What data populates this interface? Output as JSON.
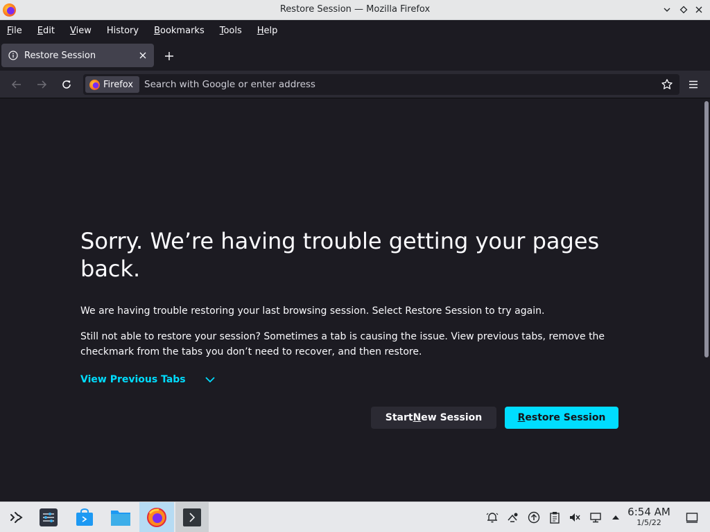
{
  "window": {
    "title": "Restore Session — Mozilla Firefox"
  },
  "menu": {
    "items": [
      {
        "label": "File",
        "mnemonic": "F",
        "rest": "ile"
      },
      {
        "label": "Edit",
        "mnemonic": "E",
        "rest": "dit"
      },
      {
        "label": "View",
        "mnemonic": "V",
        "rest": "iew"
      },
      {
        "label": "History",
        "mnemonic": "",
        "rest": "History"
      },
      {
        "label": "Bookmarks",
        "mnemonic": "B",
        "rest": "ookmarks"
      },
      {
        "label": "Tools",
        "mnemonic": "T",
        "rest": "ools"
      },
      {
        "label": "Help",
        "mnemonic": "H",
        "rest": "elp"
      }
    ]
  },
  "tabs": [
    {
      "label": "Restore Session"
    }
  ],
  "urlbar": {
    "identity_label": "Firefox",
    "placeholder": "Search with Google or enter address",
    "value": ""
  },
  "page": {
    "heading": "Sorry. We’re having trouble getting your pages back.",
    "paragraph1": "We are having trouble restoring your last browsing session. Select Restore Session to try again.",
    "paragraph2": "Still not able to restore your session? Sometimes a tab is causing the issue. View previous tabs, remove the checkmark from the tabs you don’t need to recover, and then restore.",
    "view_previous_label": "View Previous Tabs",
    "start_new_session": {
      "before": "Start ",
      "mnemonic": "N",
      "after": "ew Session"
    },
    "restore_session": {
      "before": "",
      "mnemonic": "R",
      "after": "estore Session"
    }
  },
  "taskbar": {
    "clock": {
      "time": "6:54 AM",
      "date": "1/5/22"
    }
  },
  "colors": {
    "accent": "#00ddff",
    "background": "#1c1b22",
    "toolbar": "#2b2a33"
  }
}
